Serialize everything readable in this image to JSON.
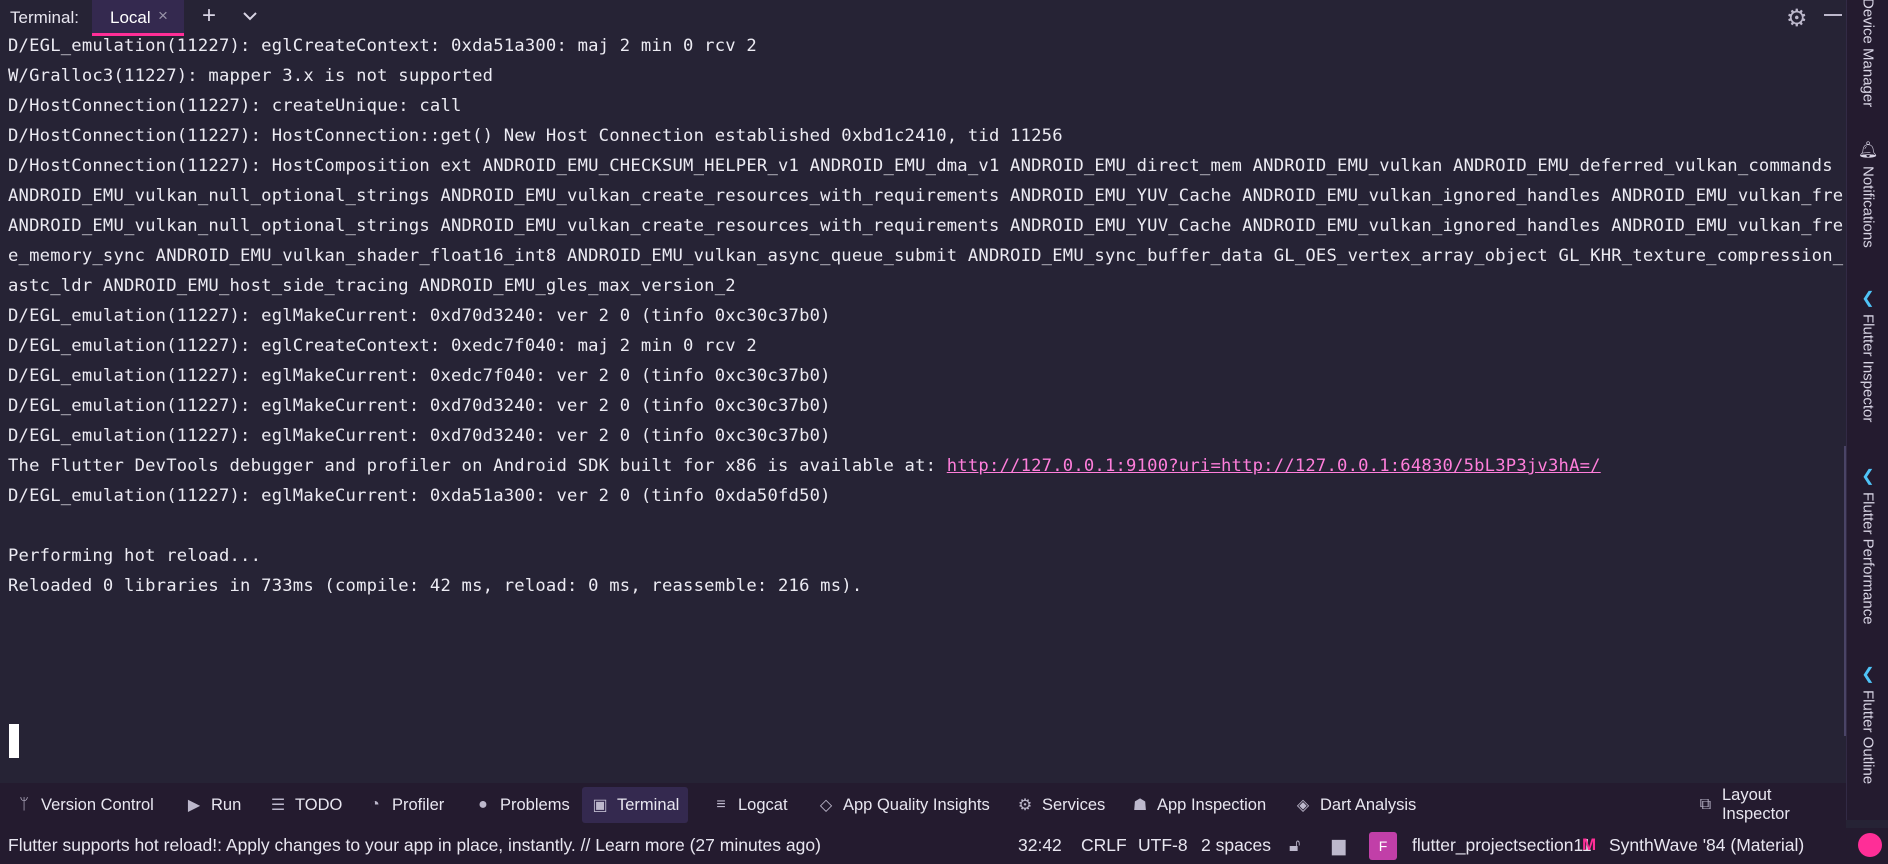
{
  "tab_bar": {
    "title": "Terminal:",
    "active_tab": "Local",
    "close_glyph": "×",
    "new_tab_glyph": "+",
    "icons": [
      "close-icon",
      "plus-icon",
      "chevron-down-icon",
      "gear-icon",
      "minimize-icon"
    ]
  },
  "terminal": {
    "lines": [
      "D/EGL_emulation(11227): eglCreateContext: 0xda51a300: maj 2 min 0 rcv 2",
      "W/Gralloc3(11227): mapper 3.x is not supported",
      "D/HostConnection(11227): createUnique: call",
      "D/HostConnection(11227): HostConnection::get() New Host Connection established 0xbd1c2410, tid 11256",
      "D/HostConnection(11227): HostComposition ext ANDROID_EMU_CHECKSUM_HELPER_v1 ANDROID_EMU_dma_v1 ANDROID_EMU_direct_mem ANDROID_EMU_vulkan ANDROID_EMU_deferred_vulkan_commands",
      "ANDROID_EMU_vulkan_null_optional_strings ANDROID_EMU_vulkan_create_resources_with_requirements ANDROID_EMU_YUV_Cache ANDROID_EMU_vulkan_ignored_handles ANDROID_EMU_vulkan_fre",
      "ANDROID_EMU_vulkan_null_optional_strings ANDROID_EMU_vulkan_create_resources_with_requirements ANDROID_EMU_YUV_Cache ANDROID_EMU_vulkan_ignored_handles ANDROID_EMU_vulkan_fre",
      "e_memory_sync ANDROID_EMU_vulkan_shader_float16_int8 ANDROID_EMU_vulkan_async_queue_submit ANDROID_EMU_sync_buffer_data GL_OES_vertex_array_object GL_KHR_texture_compression_",
      "astc_ldr ANDROID_EMU_host_side_tracing ANDROID_EMU_gles_max_version_2",
      "D/EGL_emulation(11227): eglMakeCurrent: 0xd70d3240: ver 2 0 (tinfo 0xc30c37b0)",
      "D/EGL_emulation(11227): eglCreateContext: 0xedc7f040: maj 2 min 0 rcv 2",
      "D/EGL_emulation(11227): eglMakeCurrent: 0xedc7f040: ver 2 0 (tinfo 0xc30c37b0)",
      "D/EGL_emulation(11227): eglMakeCurrent: 0xd70d3240: ver 2 0 (tinfo 0xc30c37b0)",
      "D/EGL_emulation(11227): eglMakeCurrent: 0xd70d3240: ver 2 0 (tinfo 0xc30c37b0)"
    ],
    "devtools_prefix": "The Flutter DevTools debugger and profiler on Android SDK built for x86 is available at: ",
    "devtools_link": "http://127.0.0.1:9100?uri=http://127.0.0.1:64830/5bL3P3jv3hA=/",
    "line_after_link": "D/EGL_emulation(11227): eglMakeCurrent: 0xda51a300: ver 2 0 (tinfo 0xda50fd50)",
    "hot_reload_line": "Performing hot reload...",
    "reloaded_line": "Reloaded 0 libraries in 733ms (compile: 42 ms, reload: 0 ms, reassemble: 216 ms)."
  },
  "right_sidebar": [
    {
      "label": "Device Manager",
      "icon": "device-icon"
    },
    {
      "label": "Notifications",
      "icon": "bell-icon"
    },
    {
      "label": "Flutter Inspector",
      "icon": "flutter-icon"
    },
    {
      "label": "Flutter Performance",
      "icon": "flutter-icon"
    },
    {
      "label": "Flutter Outline",
      "icon": "flutter-icon"
    }
  ],
  "tool_windows": [
    {
      "label": "Version Control",
      "icon": "branch-icon"
    },
    {
      "label": "Run",
      "icon": "play-icon"
    },
    {
      "label": "TODO",
      "icon": "list-icon"
    },
    {
      "label": "Profiler",
      "icon": "gauge-icon"
    },
    {
      "label": "Problems",
      "icon": "warning-icon"
    },
    {
      "label": "Terminal",
      "icon": "terminal-icon",
      "active": true
    },
    {
      "label": "Logcat",
      "icon": "logcat-icon"
    },
    {
      "label": "App Quality Insights",
      "icon": "diamond-icon"
    },
    {
      "label": "Services",
      "icon": "services-icon"
    },
    {
      "label": "App Inspection",
      "icon": "inspection-icon"
    },
    {
      "label": "Dart Analysis",
      "icon": "dart-icon"
    },
    {
      "label": "Layout Inspector",
      "icon": "layout-inspector-icon"
    }
  ],
  "status_bar": {
    "message": "Flutter supports hot reload!: Apply changes to your app in place, instantly. // Learn more (27 minutes ago)",
    "position": "32:42",
    "line_separator": "CRLF",
    "encoding": "UTF-8",
    "indent": "2 spaces",
    "project_badge": "F",
    "project": "flutter_projectsection11",
    "theme_badge": "M",
    "theme": "SynthWave '84 (Material)"
  },
  "colors": {
    "background": "#262335",
    "panel": "#241b2f",
    "accent_pink": "#ff2e97",
    "link": "#ff7edb",
    "flutter_blue": "#4fc3f7"
  }
}
